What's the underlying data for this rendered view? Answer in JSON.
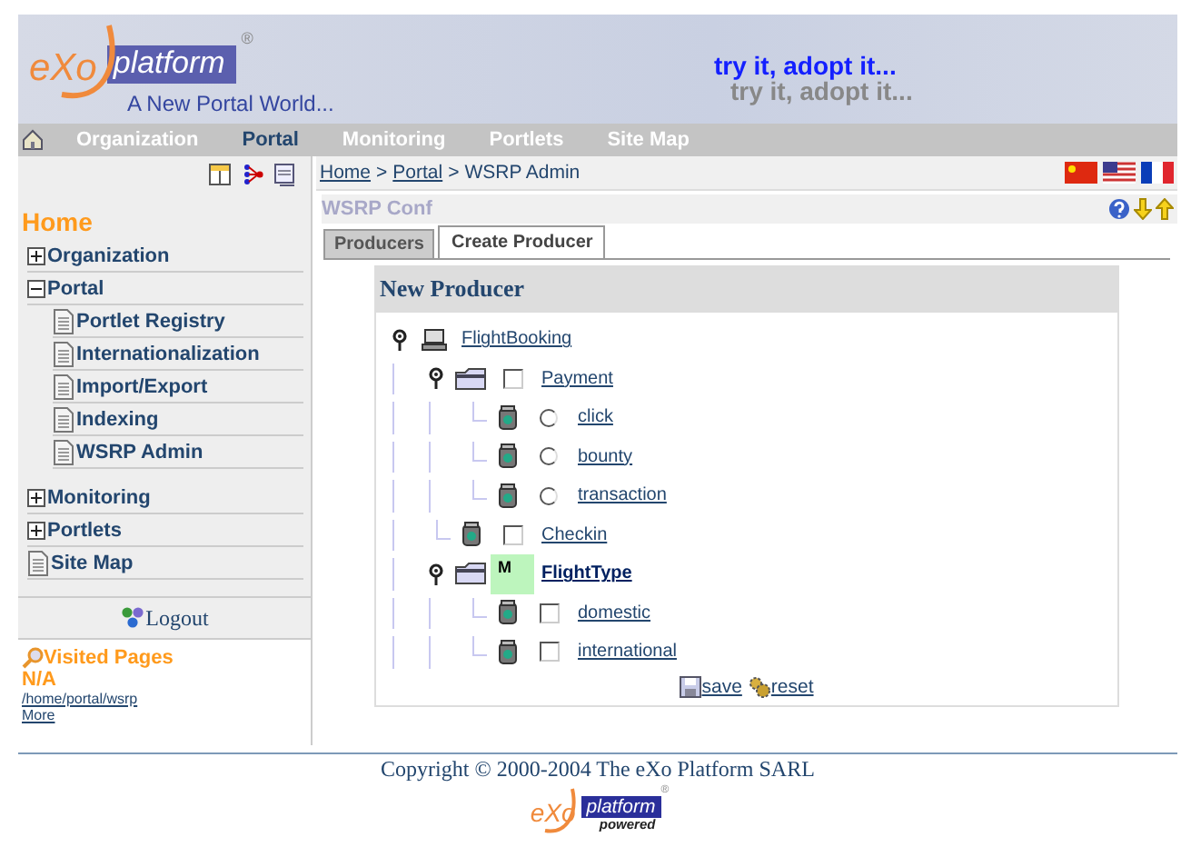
{
  "header": {
    "logo": {
      "mark": "eXo",
      "word": "platform",
      "registered": "®"
    },
    "tagline": "A New Portal World...",
    "slogan": "try it, adopt it...",
    "slogan_shadow": "try it, adopt it..."
  },
  "nav": [
    {
      "label": "Organization",
      "selected": false
    },
    {
      "label": "Portal",
      "selected": true
    },
    {
      "label": "Monitoring",
      "selected": false
    },
    {
      "label": "Portlets",
      "selected": false
    },
    {
      "label": "Site Map",
      "selected": false
    }
  ],
  "sidebar": {
    "title": "Home",
    "menu": [
      {
        "label": "Organization",
        "kind": "group",
        "expanded": false
      },
      {
        "label": "Portal",
        "kind": "group",
        "expanded": true,
        "children": [
          {
            "label": "Portlet Registry",
            "kind": "page"
          },
          {
            "label": "Internationalization",
            "kind": "page"
          },
          {
            "label": "Import/Export",
            "kind": "page"
          },
          {
            "label": "Indexing",
            "kind": "page"
          },
          {
            "label": "WSRP Admin",
            "kind": "page"
          }
        ]
      },
      {
        "label": "Monitoring",
        "kind": "group",
        "expanded": false
      },
      {
        "label": "Portlets",
        "kind": "group",
        "expanded": false
      },
      {
        "label": "Site Map",
        "kind": "page"
      }
    ],
    "logout": "Logout",
    "visited": {
      "title": "Visited Pages",
      "current": "N/A",
      "links": [
        "/home/portal/wsrp"
      ],
      "more": "More"
    }
  },
  "breadcrumb": [
    {
      "label": "Home",
      "link": true
    },
    {
      "label": ">",
      "link": false
    },
    {
      "label": "Portal",
      "link": true
    },
    {
      "label": ">",
      "link": false
    },
    {
      "label": "WSRP Admin",
      "link": false
    }
  ],
  "portlet": {
    "title": "WSRP Conf",
    "tabs": [
      {
        "label": "Producers",
        "selected": false
      },
      {
        "label": "Create Producer",
        "selected": true
      }
    ],
    "panel": {
      "title": "New Producer",
      "tree": {
        "label": "FlightBooking",
        "kind": "computer",
        "expanded": true,
        "children": [
          {
            "label": "Payment",
            "kind": "folder",
            "expanded": true,
            "checked": false,
            "children": [
              {
                "label": "click",
                "kind": "operation",
                "selected": false
              },
              {
                "label": "bounty",
                "kind": "operation",
                "selected": false
              },
              {
                "label": "transaction",
                "kind": "operation",
                "selected": false
              }
            ]
          },
          {
            "label": "Checkin",
            "kind": "operation",
            "checked": false
          },
          {
            "label": "FlightType",
            "kind": "folder",
            "expanded": true,
            "badge": "M",
            "children": [
              {
                "label": "domestic",
                "kind": "operation",
                "checked": false
              },
              {
                "label": "international",
                "kind": "operation",
                "checked": false
              }
            ]
          }
        ]
      },
      "actions": [
        {
          "label": "save",
          "kind": "save"
        },
        {
          "label": "reset",
          "kind": "reset"
        }
      ]
    }
  },
  "footer": {
    "copyright": "Copyright © 2000-2004 The eXo Platform SARL",
    "logo": {
      "mark": "eXo",
      "word": "platform",
      "registered": "®",
      "caption": "powered"
    }
  }
}
